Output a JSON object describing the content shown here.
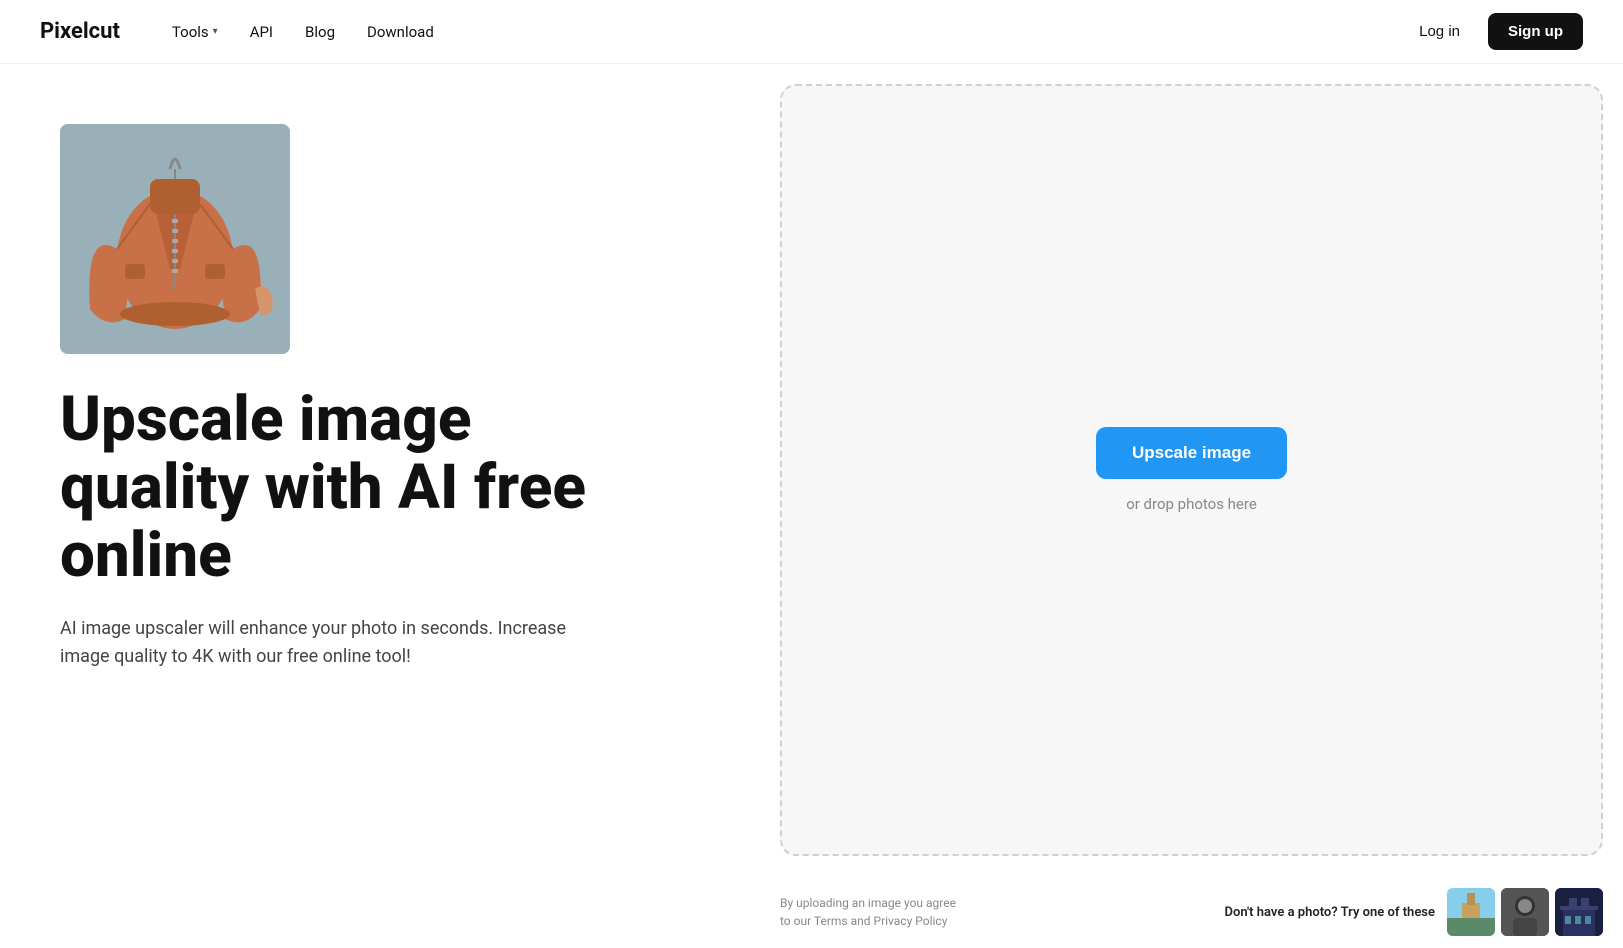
{
  "header": {
    "logo": "Pixelcut",
    "nav": {
      "tools_label": "Tools",
      "api_label": "API",
      "blog_label": "Blog",
      "download_label": "Download"
    },
    "auth": {
      "login_label": "Log in",
      "signup_label": "Sign up"
    }
  },
  "hero": {
    "title": "Upscale image quality with AI free online",
    "description": "AI image upscaler will enhance your photo in seconds. Increase image quality to 4K with our free online tool!"
  },
  "upload_area": {
    "button_label": "Upscale image",
    "drop_text": "or drop photos here"
  },
  "bottom": {
    "terms_line1": "By uploading an image you agree",
    "terms_line2": "to our Terms and Privacy Policy",
    "sample_label": "Don't have a photo?",
    "sample_sublabel": "Try one of these"
  },
  "icons": {
    "chevron": "▾"
  }
}
